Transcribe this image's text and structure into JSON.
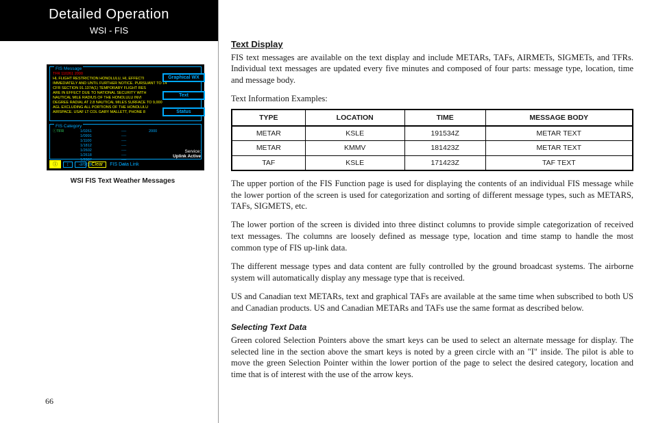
{
  "header": {
    "title": "Detailed Operation",
    "subtitle": "WSI - FIS"
  },
  "screenshot": {
    "msg_box_label": "FIS Message",
    "msg_line1": "TFR 110261 2000",
    "msg_body": "HL FLIGHT RESTRICTION HONOLULU, HI, EFFECTI\nIMMEDIATELY AND UNTIL FURTHER NOTICE. PURSUANT TO 14\nCFR SECTION 91.137A(1) TEMPORARY FLIGHT RES\nARE IN EFFECT DUE TO NATIONAL SECURITY WITH\nNAUTICAL MILE RADIUS OF THE HONOLULU INVI\nDEGREE RADIAL AT 2.8 NAUTICAL MILES SURFACE TO 9,000\nAGL EXCLUDING ALL PORTIONS OF THE HONOLULU\nAIRSPACE. USAF LT COL GARY MALLETT, PHONE 8",
    "side_buttons": [
      "Graphical WX",
      "Text",
      "Status"
    ],
    "cat_box_label": "FIS Category",
    "cat_rows": [
      {
        "c1": "ⓘTFR",
        "c2": "1/0261",
        "c3": "----",
        "c4": "2000"
      },
      {
        "c1": "",
        "c2": "1/0991",
        "c3": "----",
        "c4": ""
      },
      {
        "c1": "",
        "c2": "1/1100",
        "c3": "----",
        "c4": ""
      },
      {
        "c1": "",
        "c2": "1/1812",
        "c3": "----",
        "c4": ""
      },
      {
        "c1": "",
        "c2": "1/2602",
        "c3": "----",
        "c4": ""
      },
      {
        "c1": "",
        "c2": "1/2618",
        "c3": "----",
        "c4": ""
      },
      {
        "c1": "",
        "c2": "1/2887",
        "c3": "----",
        "c4": ""
      },
      {
        "c1": "",
        "c2": "2/0229",
        "c3": "----",
        "c4": ""
      }
    ],
    "service_label": "Service:",
    "service_value": "Uplink Active",
    "bottom_keys": {
      "star": "ⓘ",
      "arrows": [
        "↕",
        "↔"
      ],
      "clear": "Clear",
      "datalink": "FIS Data Link"
    }
  },
  "caption": "WSI FIS Text Weather Messages",
  "section": {
    "title": "Text Display",
    "intro": "FIS text messages are available on the text display and include METARs, TAFs, AIRMETs, SIGMETs, and TFRs. Individual text messages are updated every five minutes and composed of four parts: message type, location, time and message body.",
    "examples_label": "Text Information Examples:",
    "table": {
      "headers": [
        "TYPE",
        "LOCATION",
        "TIME",
        "MESSAGE BODY"
      ],
      "rows": [
        [
          "METAR",
          "KSLE",
          "191534Z",
          "METAR TEXT"
        ],
        [
          "METAR",
          "KMMV",
          "181423Z",
          "METAR TEXT"
        ],
        [
          "TAF",
          "KSLE",
          "171423Z",
          "TAF TEXT"
        ]
      ]
    },
    "p1": "The upper portion of the FIS Function page is used for displaying the contents of an individual FIS message while the lower portion of the screen is used for categorization and sorting of different message types, such as METARS, TAFs, SIGMETS, etc.",
    "p2": "The lower portion of the screen is divided into three distinct columns to provide simple categorization of received text messages. The columns are loosely defined as message type, location and time stamp to handle the most common type of FIS up-link data.",
    "p3": "The different message types and data content are fully controlled by the ground broadcast systems. The airborne system will automatically display any message type that is received.",
    "p4": "US and Canadian text METARs, text and graphical TAFs are available at the same time when subscribed to both US and Canadian products. US and Canadian METARs and TAFs use the same format as described below."
  },
  "subsection": {
    "title": "Selecting Text Data",
    "body": "Green colored Selection Pointers above the smart keys can be used to select an alternate message for display. The selected line in the section above the smart keys is noted by a green circle with an \"I\" inside. The pilot is able to move the green Selection Pointer within the lower portion of the page to select the desired category, location and time that is of interest with the use of the arrow keys."
  },
  "page_number": "66"
}
